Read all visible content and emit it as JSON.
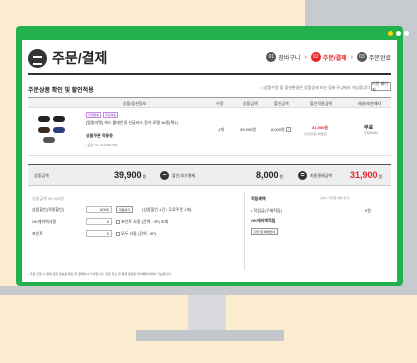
{
  "colors": {
    "brand_green": "#22b14c",
    "accent_red": "#e8232a",
    "background": "#fcecd0",
    "frame_gray": "#c7cbd0"
  },
  "window_dots": [
    "#ffd200",
    "#ffffff",
    "#ffffff"
  ],
  "header": {
    "title": "주문/결제",
    "icon": "cart-icon"
  },
  "steps": [
    {
      "num": "01",
      "label": "장바구니",
      "color": "#555555"
    },
    {
      "num": "02",
      "label": "주문/결제",
      "color": "#e8232a"
    },
    {
      "num": "03",
      "label": "주문완료",
      "color": "#555555"
    }
  ],
  "section": {
    "title": "주문상품 확인 및 할인적용",
    "note": "• 상품수량 및 옵션변경은 상품상세 또는 장바구니에서 가능합니다.",
    "button": "이전 페이지"
  },
  "table": {
    "headers": [
      "상품/옵션정보",
      "수량",
      "상품금액",
      "할인금액",
      "할인적용금액",
      "배송비/판매자"
    ],
    "product": {
      "badges": [
        "당일발송",
        "무료배송"
      ],
      "name": "[알뜰마켓] 게스 뿔테안경 선글라스 정가 모델 36종(택1)",
      "gift": "상품쿠폰 적용중",
      "code": "• 옵션: 01. GU2580-056",
      "qty": "1개",
      "price": "39,900원",
      "discount": "8,000원",
      "discount_icon": "i",
      "final": "31,900원",
      "final_sub": "(할인쿠폰+적립금)",
      "shipping": "무료",
      "seller": "한다라세미"
    }
  },
  "summary": {
    "product_label": "상품금액",
    "product_value": "39,900",
    "discount_label": "할인/부가결제",
    "discount_value": "8,000",
    "total_label": "최종결제금액",
    "total_value": "31,900",
    "unit": "원",
    "minus": "−",
    "equals": "="
  },
  "coupons": {
    "heading": "상품금액 39,900원",
    "rows": [
      {
        "label": "상품할인(적용할인)",
        "value": "8000",
        "button": "적용하기",
        "extra": "(상품할인 1건 / 무료주문 1개)"
      },
      {
        "label": "OK캐쉬백사용",
        "value": "0",
        "button": "",
        "extra": "포인트 사용 (잔액 : 0P)  조회"
      },
      {
        "label": "포인트",
        "value": "0",
        "button": "",
        "extra": "모두 사용 (잔여 : 0P)"
      }
    ]
  },
  "benefits": {
    "title": "적립혜택",
    "note": "구매시 적립될 혜택 안내",
    "rows": [
      {
        "label": "• 적립금(구매적립)",
        "value": "0원"
      },
      {
        "label": "OK캐쉬백적립",
        "value": ""
      }
    ],
    "button": "할인 및 혜택안내"
  },
  "footnote": "• 주문 진행 시 결제 관련 정보를 확인 후 결제하시기 바랍니다. 주문 취소 및 결제 변경은 마이페이지에서 가능합니다."
}
